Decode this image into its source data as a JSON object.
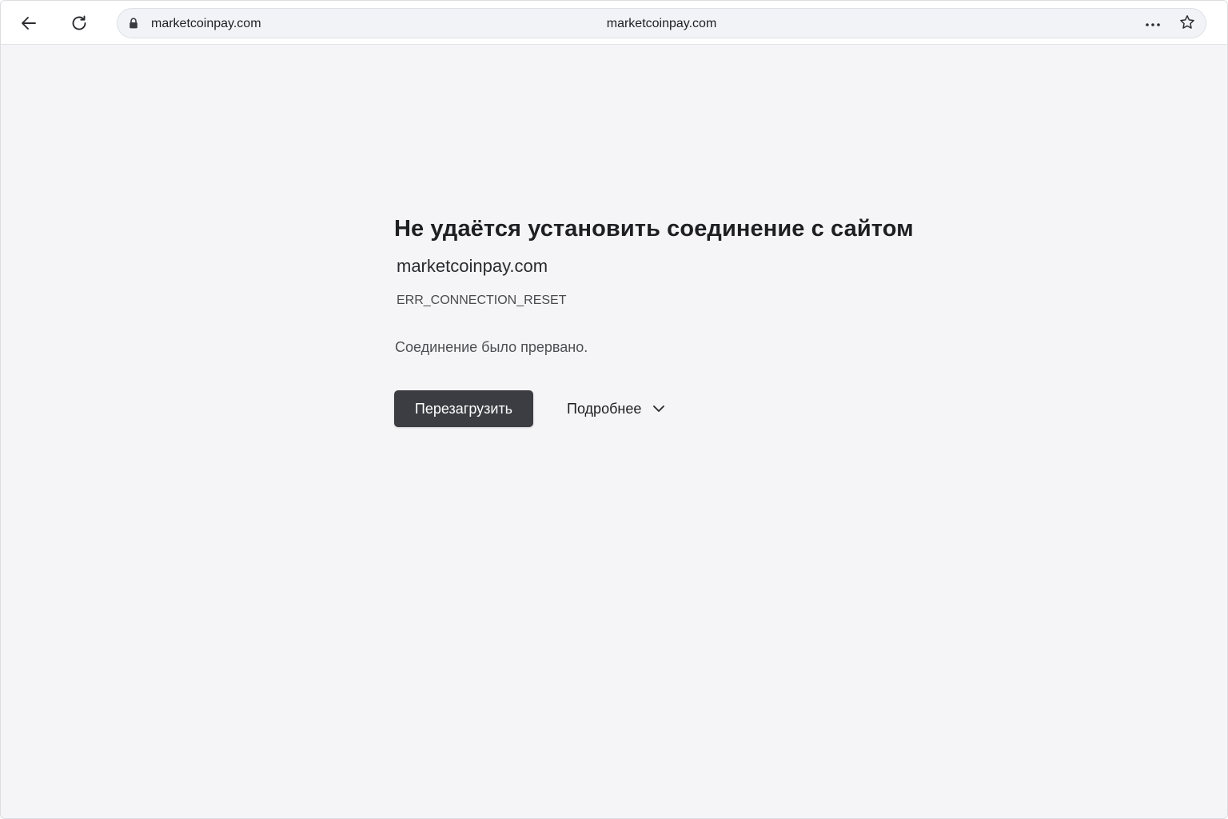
{
  "browser": {
    "address_bar": {
      "url_left": "marketcoinpay.com",
      "url_center": "marketcoinpay.com"
    },
    "icons": {
      "back": "back-arrow-icon",
      "reload": "reload-icon",
      "lock": "lock-icon",
      "more": "more-dots-icon",
      "bookmark": "star-icon"
    }
  },
  "error_page": {
    "title": "Не удаётся установить соединение с сайтом",
    "host": "marketcoinpay.com",
    "code": "ERR_CONNECTION_RESET",
    "description": "Соединение было прервано.",
    "reload_label": "Перезагрузить",
    "details_label": "Подробнее"
  },
  "colors": {
    "page_background": "#f5f5f7",
    "button_background": "#3c3d42",
    "button_text": "#ffffff"
  }
}
